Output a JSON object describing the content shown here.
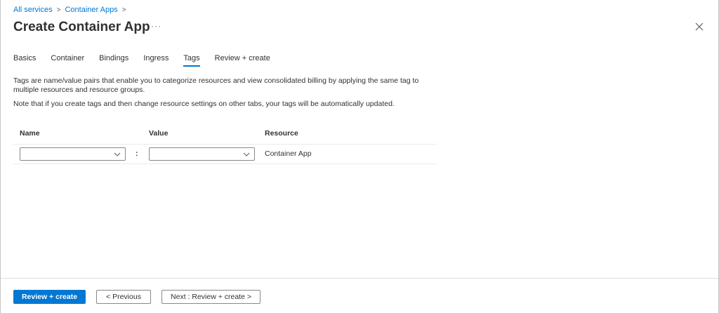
{
  "breadcrumb": {
    "items": [
      "All services",
      "Container Apps"
    ],
    "separator": ">"
  },
  "header": {
    "title": "Create Container App",
    "more": "···"
  },
  "tabs": [
    {
      "label": "Basics",
      "active": false
    },
    {
      "label": "Container",
      "active": false
    },
    {
      "label": "Bindings",
      "active": false
    },
    {
      "label": "Ingress",
      "active": false
    },
    {
      "label": "Tags",
      "active": true
    },
    {
      "label": "Review + create",
      "active": false
    }
  ],
  "description": {
    "line1": "Tags are name/value pairs that enable you to categorize resources and view consolidated billing by applying the same tag to multiple resources and resource groups.",
    "line2": "Note that if you create tags and then change resource settings on other tabs, your tags will be automatically updated."
  },
  "tag_table": {
    "headers": {
      "name": "Name",
      "value": "Value",
      "resource": "Resource"
    },
    "rows": [
      {
        "name": "",
        "value": "",
        "separator": ":",
        "resource": "Container App"
      }
    ]
  },
  "footer": {
    "primary": "Review + create",
    "previous": "< Previous",
    "next": "Next : Review + create >"
  },
  "colors": {
    "accent": "#0078d4",
    "text": "#323130",
    "border": "#8a8886"
  }
}
